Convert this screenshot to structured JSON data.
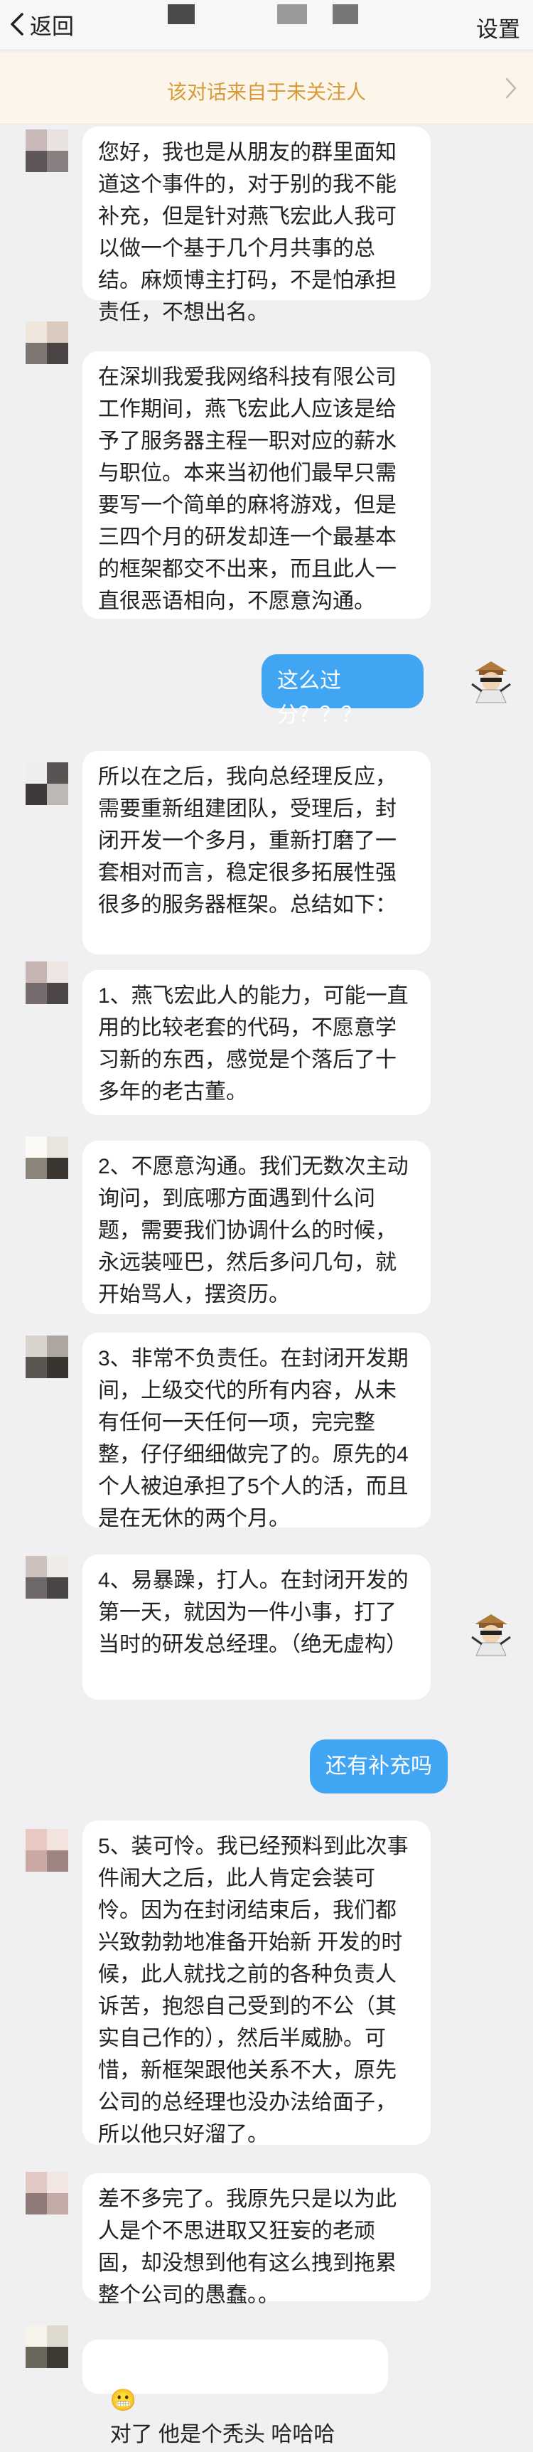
{
  "header": {
    "back_label": "返回",
    "settings_label": "设置"
  },
  "notice": {
    "text": "该对话来自于未关注人"
  },
  "messages": [
    {
      "id": "m1",
      "side": "in",
      "text": "您好，我也是从朋友的群里面知道这个事件的，对于别的我不能补充，但是针对燕飞宏此人我可以做一个基于几个月共事的总结。麻烦博主打码，不是怕承担责任，不想出名。"
    },
    {
      "id": "m2",
      "side": "in",
      "text": "在深圳我爱我网络科技有限公司工作期间，燕飞宏此人应该是给予了服务器主程一职对应的薪水与职位。本来当初他们最早只需要写一个简单的麻将游戏，但是三四个月的研发却连一个最基本的框架都交不出来，而且此人一直很恶语相向，不愿意沟通。"
    },
    {
      "id": "m3",
      "side": "out",
      "text": "这么过分？？？"
    },
    {
      "id": "m4",
      "side": "in",
      "text": "所以在之后，我向总经理反应，需要重新组建团队，受理后，封闭开发一个多月，重新打磨了一套相对而言，稳定很多拓展性强很多的服务器框架。总结如下："
    },
    {
      "id": "m5",
      "side": "in",
      "text": "1、燕飞宏此人的能力，可能一直用的比较老套的代码，不愿意学习新的东西，感觉是个落后了十多年的老古董。"
    },
    {
      "id": "m6",
      "side": "in",
      "text": "2、不愿意沟通。我们无数次主动询问，到底哪方面遇到什么问题，需要我们协调什么的时候，永远装哑巴，然后多问几句，就开始骂人，摆资历。"
    },
    {
      "id": "m7",
      "side": "in",
      "text": "3、非常不负责任。在封闭开发期间，上级交代的所有内容，从未有任何一天任何一项，完完整整，仔仔细细做完了的。原先的4个人被迫承担了5个人的活，而且是在无休的两个月。"
    },
    {
      "id": "m8",
      "side": "in",
      "text": "4、易暴躁，打人。在封闭开发的第一天，就因为一件小事，打了当时的研发总经理。（绝无虚构）"
    },
    {
      "id": "m9",
      "side": "out",
      "text": "还有补充吗"
    },
    {
      "id": "m10",
      "side": "in",
      "text": "5、装可怜。我已经预料到此次事件闹大之后，此人肯定会装可怜。因为在封闭结束后，我们都兴致勃勃地准备开始新 开发的时候，此人就找之前的各种负责人诉苦，抱怨自己受到的不公（其实自己作的），然后半威胁。可惜，新框架跟他关系不大，原先公司的总经理也没办法给面子，所以他只好溜了。"
    },
    {
      "id": "m11",
      "side": "in",
      "text": "差不多完了。我原先只是以为此人是个不思进取又狂妄的老顽固，却没想到他有这么拽到拖累整个公司的愚蠢。。"
    },
    {
      "id": "m12",
      "side": "in",
      "emoji": "😬",
      "text": "对了 他是个秃头 哈哈哈"
    }
  ],
  "colors": {
    "background": "#f0eff2",
    "incoming_bubble": "#ffffff",
    "outgoing_bubble": "#40a6f3",
    "notice_text": "#d89b3c",
    "notice_bg": "#fbf5ea"
  },
  "icons": {
    "back": "chevron-left-icon",
    "notice_arrow": "chevron-right-icon"
  }
}
